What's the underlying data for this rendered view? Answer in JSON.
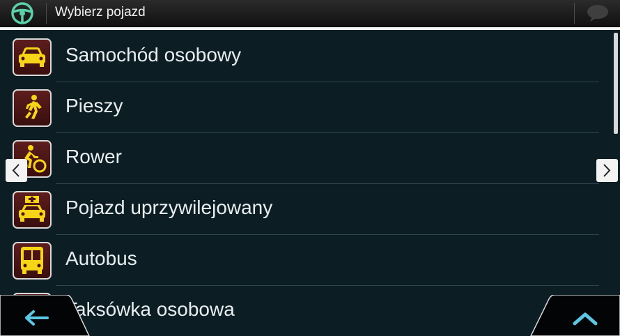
{
  "header": {
    "title": "Wybierz pojazd",
    "left_icon": "steering-wheel-icon",
    "right_icon": "chat-bubble-icon"
  },
  "vehicles": [
    {
      "label": "Samochód osobowy",
      "icon": "car-icon"
    },
    {
      "label": "Pieszy",
      "icon": "pedestrian-icon"
    },
    {
      "label": "Rower",
      "icon": "bicycle-icon"
    },
    {
      "label": "Pojazd uprzywilejowany",
      "icon": "ambulance-icon"
    },
    {
      "label": "Autobus",
      "icon": "bus-icon"
    },
    {
      "label": "Taksówka osobowa",
      "icon": "taxi-icon"
    }
  ],
  "nav": {
    "prev_icon": "chevron-left-icon",
    "next_icon": "chevron-right-icon",
    "back_icon": "arrow-left-icon",
    "up_icon": "chevron-up-icon"
  },
  "colors": {
    "background": "#0d1d24",
    "icon_yellow": "#f7d417",
    "icon_bg": "#4a1414",
    "accent_cyan": "#5bc7e3"
  }
}
